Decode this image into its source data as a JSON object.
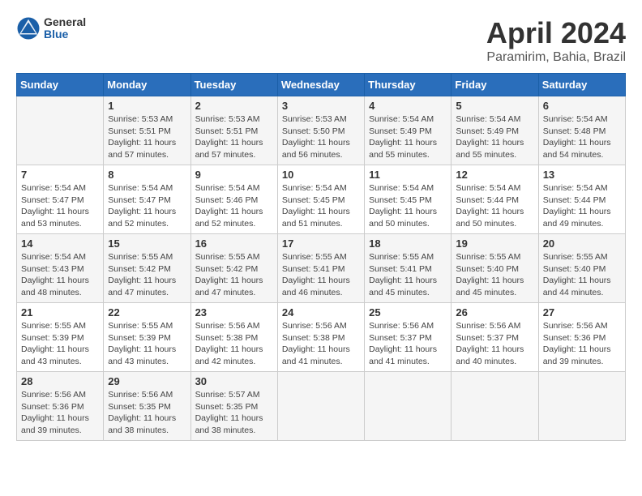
{
  "header": {
    "logo_general": "General",
    "logo_blue": "Blue",
    "month_year": "April 2024",
    "location": "Paramirim, Bahia, Brazil"
  },
  "days_of_week": [
    "Sunday",
    "Monday",
    "Tuesday",
    "Wednesday",
    "Thursday",
    "Friday",
    "Saturday"
  ],
  "weeks": [
    [
      {
        "day": "",
        "info": ""
      },
      {
        "day": "1",
        "info": "Sunrise: 5:53 AM\nSunset: 5:51 PM\nDaylight: 11 hours\nand 57 minutes."
      },
      {
        "day": "2",
        "info": "Sunrise: 5:53 AM\nSunset: 5:51 PM\nDaylight: 11 hours\nand 57 minutes."
      },
      {
        "day": "3",
        "info": "Sunrise: 5:53 AM\nSunset: 5:50 PM\nDaylight: 11 hours\nand 56 minutes."
      },
      {
        "day": "4",
        "info": "Sunrise: 5:54 AM\nSunset: 5:49 PM\nDaylight: 11 hours\nand 55 minutes."
      },
      {
        "day": "5",
        "info": "Sunrise: 5:54 AM\nSunset: 5:49 PM\nDaylight: 11 hours\nand 55 minutes."
      },
      {
        "day": "6",
        "info": "Sunrise: 5:54 AM\nSunset: 5:48 PM\nDaylight: 11 hours\nand 54 minutes."
      }
    ],
    [
      {
        "day": "7",
        "info": "Sunrise: 5:54 AM\nSunset: 5:47 PM\nDaylight: 11 hours\nand 53 minutes."
      },
      {
        "day": "8",
        "info": "Sunrise: 5:54 AM\nSunset: 5:47 PM\nDaylight: 11 hours\nand 52 minutes."
      },
      {
        "day": "9",
        "info": "Sunrise: 5:54 AM\nSunset: 5:46 PM\nDaylight: 11 hours\nand 52 minutes."
      },
      {
        "day": "10",
        "info": "Sunrise: 5:54 AM\nSunset: 5:45 PM\nDaylight: 11 hours\nand 51 minutes."
      },
      {
        "day": "11",
        "info": "Sunrise: 5:54 AM\nSunset: 5:45 PM\nDaylight: 11 hours\nand 50 minutes."
      },
      {
        "day": "12",
        "info": "Sunrise: 5:54 AM\nSunset: 5:44 PM\nDaylight: 11 hours\nand 50 minutes."
      },
      {
        "day": "13",
        "info": "Sunrise: 5:54 AM\nSunset: 5:44 PM\nDaylight: 11 hours\nand 49 minutes."
      }
    ],
    [
      {
        "day": "14",
        "info": "Sunrise: 5:54 AM\nSunset: 5:43 PM\nDaylight: 11 hours\nand 48 minutes."
      },
      {
        "day": "15",
        "info": "Sunrise: 5:55 AM\nSunset: 5:42 PM\nDaylight: 11 hours\nand 47 minutes."
      },
      {
        "day": "16",
        "info": "Sunrise: 5:55 AM\nSunset: 5:42 PM\nDaylight: 11 hours\nand 47 minutes."
      },
      {
        "day": "17",
        "info": "Sunrise: 5:55 AM\nSunset: 5:41 PM\nDaylight: 11 hours\nand 46 minutes."
      },
      {
        "day": "18",
        "info": "Sunrise: 5:55 AM\nSunset: 5:41 PM\nDaylight: 11 hours\nand 45 minutes."
      },
      {
        "day": "19",
        "info": "Sunrise: 5:55 AM\nSunset: 5:40 PM\nDaylight: 11 hours\nand 45 minutes."
      },
      {
        "day": "20",
        "info": "Sunrise: 5:55 AM\nSunset: 5:40 PM\nDaylight: 11 hours\nand 44 minutes."
      }
    ],
    [
      {
        "day": "21",
        "info": "Sunrise: 5:55 AM\nSunset: 5:39 PM\nDaylight: 11 hours\nand 43 minutes."
      },
      {
        "day": "22",
        "info": "Sunrise: 5:55 AM\nSunset: 5:39 PM\nDaylight: 11 hours\nand 43 minutes."
      },
      {
        "day": "23",
        "info": "Sunrise: 5:56 AM\nSunset: 5:38 PM\nDaylight: 11 hours\nand 42 minutes."
      },
      {
        "day": "24",
        "info": "Sunrise: 5:56 AM\nSunset: 5:38 PM\nDaylight: 11 hours\nand 41 minutes."
      },
      {
        "day": "25",
        "info": "Sunrise: 5:56 AM\nSunset: 5:37 PM\nDaylight: 11 hours\nand 41 minutes."
      },
      {
        "day": "26",
        "info": "Sunrise: 5:56 AM\nSunset: 5:37 PM\nDaylight: 11 hours\nand 40 minutes."
      },
      {
        "day": "27",
        "info": "Sunrise: 5:56 AM\nSunset: 5:36 PM\nDaylight: 11 hours\nand 39 minutes."
      }
    ],
    [
      {
        "day": "28",
        "info": "Sunrise: 5:56 AM\nSunset: 5:36 PM\nDaylight: 11 hours\nand 39 minutes."
      },
      {
        "day": "29",
        "info": "Sunrise: 5:56 AM\nSunset: 5:35 PM\nDaylight: 11 hours\nand 38 minutes."
      },
      {
        "day": "30",
        "info": "Sunrise: 5:57 AM\nSunset: 5:35 PM\nDaylight: 11 hours\nand 38 minutes."
      },
      {
        "day": "",
        "info": ""
      },
      {
        "day": "",
        "info": ""
      },
      {
        "day": "",
        "info": ""
      },
      {
        "day": "",
        "info": ""
      }
    ]
  ]
}
